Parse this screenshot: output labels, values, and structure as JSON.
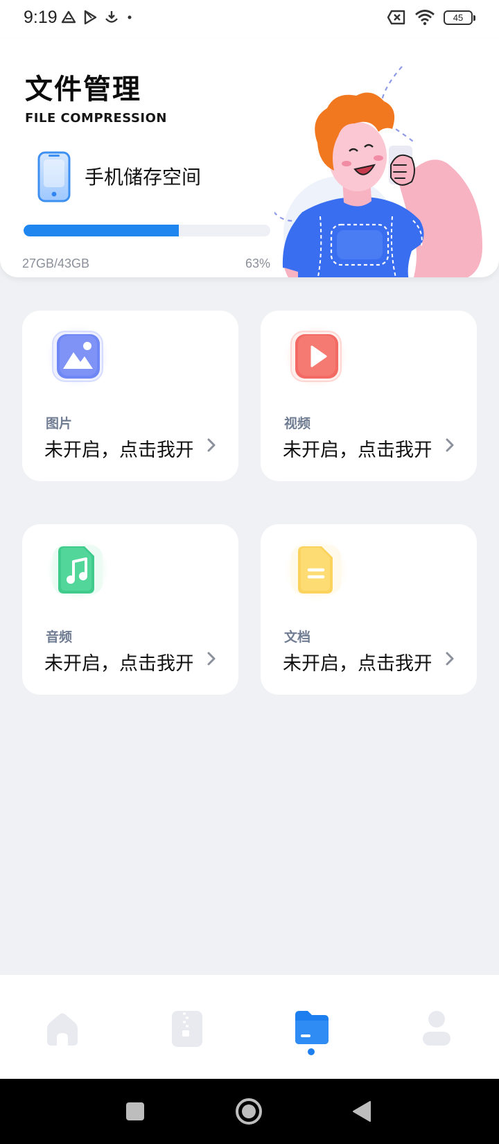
{
  "status_bar": {
    "time": "9:19",
    "battery": "45",
    "icons": [
      "drive-icon",
      "play-store-icon",
      "download-icon",
      "dot-icon",
      "sim-x-icon",
      "wifi-icon",
      "battery-icon"
    ]
  },
  "header": {
    "title": "文件管理",
    "subtitle": "FILE COMPRESSION",
    "storage_label": "手机储存空间",
    "storage_used": "27GB/43GB",
    "storage_percent": "63%",
    "storage_fraction": 0.63,
    "accent_color": "#1f86f0"
  },
  "categories": [
    {
      "title": "图片",
      "status": "未开启，点击我开启",
      "icon": "image-icon",
      "color": "#6f86f5"
    },
    {
      "title": "视频",
      "status": "未开启，点击我开启",
      "icon": "video-play-icon",
      "color": "#f26a63"
    },
    {
      "title": "音频",
      "status": "未开启，点击我开启",
      "icon": "music-note-icon",
      "color": "#3fcb8c"
    },
    {
      "title": "文档",
      "status": "未开启，点击我开启",
      "icon": "document-icon",
      "color": "#fbd25c"
    }
  ],
  "bottom_nav": {
    "items": [
      {
        "icon": "home-icon",
        "active": false
      },
      {
        "icon": "zip-archive-icon",
        "active": false
      },
      {
        "icon": "folder-icon",
        "active": true
      },
      {
        "icon": "user-icon",
        "active": false
      }
    ],
    "active_color": "#1d7ef0",
    "inactive_color": "#e8eaef"
  },
  "system_nav": [
    "recent-apps-icon",
    "home-circle-icon",
    "back-icon"
  ]
}
